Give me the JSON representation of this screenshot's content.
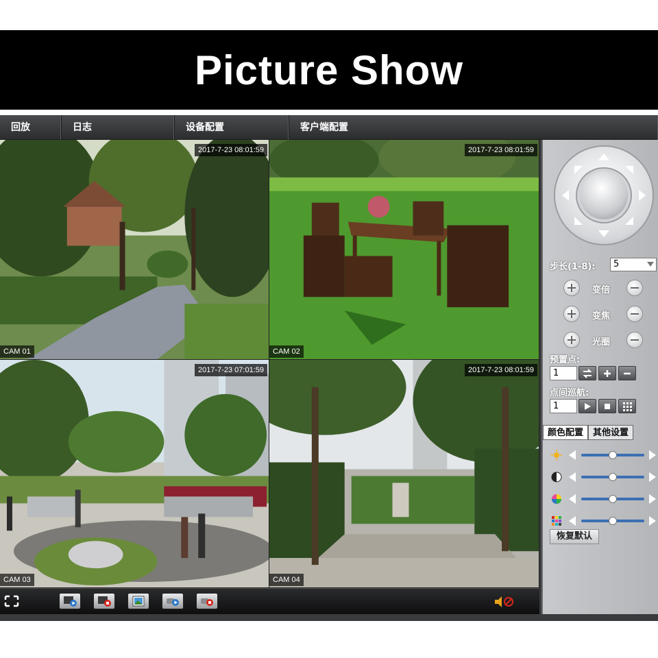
{
  "banner": {
    "title": "Picture Show"
  },
  "menu": {
    "items": [
      {
        "label": "回放"
      },
      {
        "label": "日志"
      },
      {
        "label": "设备配置"
      },
      {
        "label": "客户端配置"
      }
    ]
  },
  "cameras": [
    {
      "label": "CAM 01",
      "timestamp": "2017-7-23 08:01:59"
    },
    {
      "label": "CAM 02",
      "timestamp": "2017-7-23 08:01:59"
    },
    {
      "label": "CAM 03",
      "timestamp": "2017-7-23 07:01:59"
    },
    {
      "label": "CAM 04",
      "timestamp": "2017-7-23 08:01:59"
    }
  ],
  "ptz": {
    "step_label": "步长(1-8):",
    "step_value": "5",
    "zoom_label": "变倍",
    "focus_label": "变焦",
    "iris_label": "光圈",
    "preset_label": "预置点:",
    "preset_value": "1",
    "cruise_label": "点间巡航:",
    "cruise_value": "1"
  },
  "tabs": {
    "color_config": "颜色配置",
    "other_settings": "其他设置"
  },
  "color_sliders": [
    {
      "name": "brightness",
      "level": 0.5
    },
    {
      "name": "contrast",
      "level": 0.5
    },
    {
      "name": "saturation",
      "level": 0.5
    },
    {
      "name": "hue",
      "level": 0.5
    }
  ],
  "reset_label": "恢复默认",
  "colors": {
    "accent_blue": "#3c6fb4",
    "mute_red": "#d8261c"
  }
}
